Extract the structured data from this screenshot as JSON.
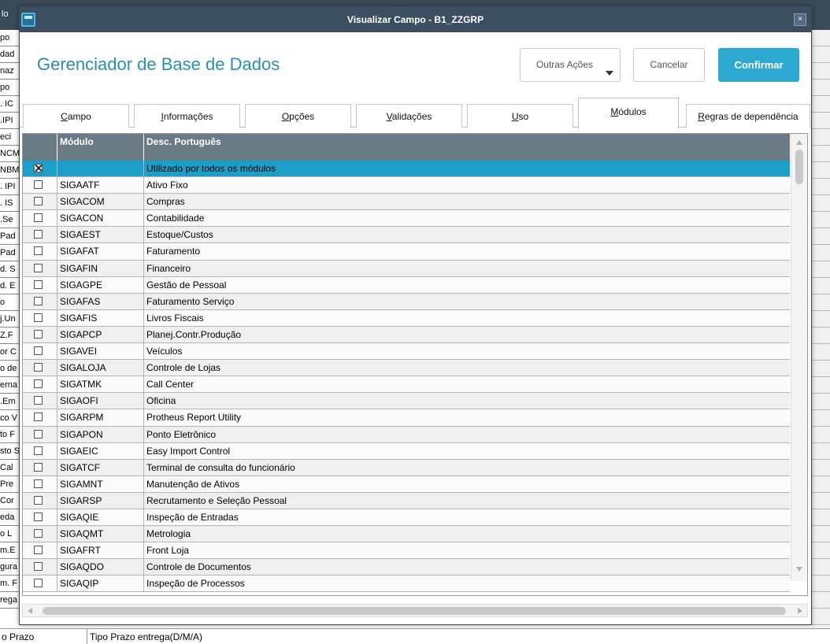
{
  "background": {
    "topbar_label": "lo",
    "left_column": [
      "po",
      "dad",
      "naz",
      "po",
      ". IC",
      ".IPI",
      "eci",
      "NCM",
      "NBM",
      ". IPI",
      ". IS",
      ".Se",
      "Pad",
      "Pad",
      "d. S",
      "d. E",
      "o",
      "j.Un",
      "Z.F",
      "or C",
      "o de",
      "erna",
      ".Em",
      "co V",
      "to F",
      "sto S",
      "Cal",
      "Pre",
      "Cor",
      "eda",
      "o L",
      "m.E",
      "gura",
      "m. F",
      "rega"
    ],
    "bottom_row": {
      "col1": "o Prazo",
      "col2": "Tipo Prazo entrega(D/M/A)"
    }
  },
  "dialog": {
    "window_title": "Visualizar Campo - B1_ZZGRP",
    "close_label": "×",
    "app_title": "Gerenciador de Base de Dados",
    "buttons": {
      "outras_acoes": "Outras Ações",
      "cancelar": "Cancelar",
      "confirmar": "Confirmar"
    },
    "tabs": [
      {
        "label": "Campo",
        "active": false
      },
      {
        "label": "Informações",
        "active": false
      },
      {
        "label": "Opções",
        "active": false
      },
      {
        "label": "Validações",
        "active": false
      },
      {
        "label": "Uso",
        "active": false
      },
      {
        "label": "Módulos",
        "active": true
      },
      {
        "label": "Regras de dependência",
        "active": false
      }
    ],
    "grid": {
      "columns": [
        "",
        "Módulo",
        "Desc. Português"
      ],
      "rows": [
        {
          "checked": true,
          "modulo": "",
          "desc": "Utilizado por todos os módulos",
          "selected": true
        },
        {
          "checked": false,
          "modulo": "SIGAATF",
          "desc": "Ativo Fixo"
        },
        {
          "checked": false,
          "modulo": "SIGACOM",
          "desc": "Compras"
        },
        {
          "checked": false,
          "modulo": "SIGACON",
          "desc": "Contabilidade"
        },
        {
          "checked": false,
          "modulo": "SIGAEST",
          "desc": "Estoque/Custos"
        },
        {
          "checked": false,
          "modulo": "SIGAFAT",
          "desc": "Faturamento"
        },
        {
          "checked": false,
          "modulo": "SIGAFIN",
          "desc": "Financeiro"
        },
        {
          "checked": false,
          "modulo": "SIGAGPE",
          "desc": "Gestão de Pessoal"
        },
        {
          "checked": false,
          "modulo": "SIGAFAS",
          "desc": "Faturamento Serviço"
        },
        {
          "checked": false,
          "modulo": "SIGAFIS",
          "desc": "Livros Fiscais"
        },
        {
          "checked": false,
          "modulo": "SIGAPCP",
          "desc": "Planej.Contr.Produção"
        },
        {
          "checked": false,
          "modulo": "SIGAVEI",
          "desc": "Veículos"
        },
        {
          "checked": false,
          "modulo": "SIGALOJA",
          "desc": "Controle de Lojas"
        },
        {
          "checked": false,
          "modulo": "SIGATMK",
          "desc": "Call Center"
        },
        {
          "checked": false,
          "modulo": "SIGAOFI",
          "desc": "Oficina"
        },
        {
          "checked": false,
          "modulo": "SIGARPM",
          "desc": "Protheus Report Utility"
        },
        {
          "checked": false,
          "modulo": "SIGAPON",
          "desc": "Ponto Eletrônico"
        },
        {
          "checked": false,
          "modulo": "SIGAEIC",
          "desc": "Easy Import Control"
        },
        {
          "checked": false,
          "modulo": "SIGATCF",
          "desc": "Terminal de consulta do funcionário"
        },
        {
          "checked": false,
          "modulo": "SIGAMNT",
          "desc": "Manutenção de Ativos"
        },
        {
          "checked": false,
          "modulo": "SIGARSP",
          "desc": "Recrutamento e Seleção Pessoal"
        },
        {
          "checked": false,
          "modulo": "SIGAQIE",
          "desc": "Inspeção de Entradas"
        },
        {
          "checked": false,
          "modulo": "SIGAQMT",
          "desc": "Metrologia"
        },
        {
          "checked": false,
          "modulo": "SIGAFRT",
          "desc": "Front Loja"
        },
        {
          "checked": false,
          "modulo": "SIGAQDO",
          "desc": "Controle de Documentos"
        },
        {
          "checked": false,
          "modulo": "SIGAQIP",
          "desc": "Inspeção de Processos"
        }
      ]
    }
  },
  "colors": {
    "titlebar": "#3c4f61",
    "accent": "#2ca8d2",
    "selected_row": "#1aa0c8",
    "grid_header": "#6a7b86"
  }
}
